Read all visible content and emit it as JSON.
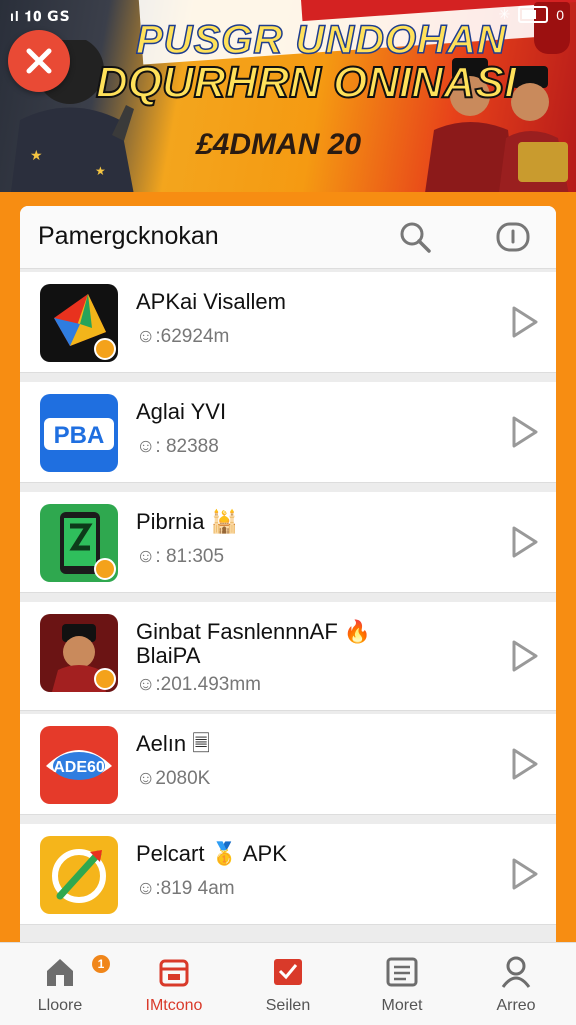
{
  "status_bar": {
    "left": "ıl 𝟏𝟎 𝗚𝗦",
    "right_a": "✳",
    "right_b": "0"
  },
  "banner": {
    "line1": "PUSGR UNDOHAN",
    "line2": "DQURHRN ONINASI",
    "promo": "£4DMAN 20",
    "close_label": "×"
  },
  "panel": {
    "title": "Pamergcknokan"
  },
  "apps": [
    {
      "name": "APKai Visallem",
      "meta": "☺:62924m",
      "icon": "kite-app-icon"
    },
    {
      "name": "Aglai YVI",
      "meta": "☺: 82388",
      "icon": "pba-app-icon"
    },
    {
      "name": "Pibrnia 🕌",
      "meta": "☺: 81:305",
      "icon": "phone-s-app-icon"
    },
    {
      "name": "Ginbat FasnlennnAF 🔥",
      "name2": "BlaiPA",
      "meta": "☺:201.493mm",
      "icon": "soldier-app-icon"
    },
    {
      "name": "Aelın 🗏",
      "meta": "☺2080K",
      "icon": "ade-app-icon"
    },
    {
      "name": "Pelcart 🥇 APK",
      "meta": "☺:819 4am",
      "icon": "compass-app-icon"
    }
  ],
  "bottom_nav": [
    {
      "label": "Lloore",
      "icon": "home-icon",
      "badge": "1"
    },
    {
      "label": "IMtcono",
      "icon": "store-icon",
      "active": true
    },
    {
      "label": "Seilen",
      "icon": "chart-icon"
    },
    {
      "label": "Moret",
      "icon": "list-icon"
    },
    {
      "label": "Arreo",
      "icon": "user-icon"
    }
  ],
  "colors": {
    "accent": "#f78d12",
    "active_nav": "#d93a2a"
  }
}
